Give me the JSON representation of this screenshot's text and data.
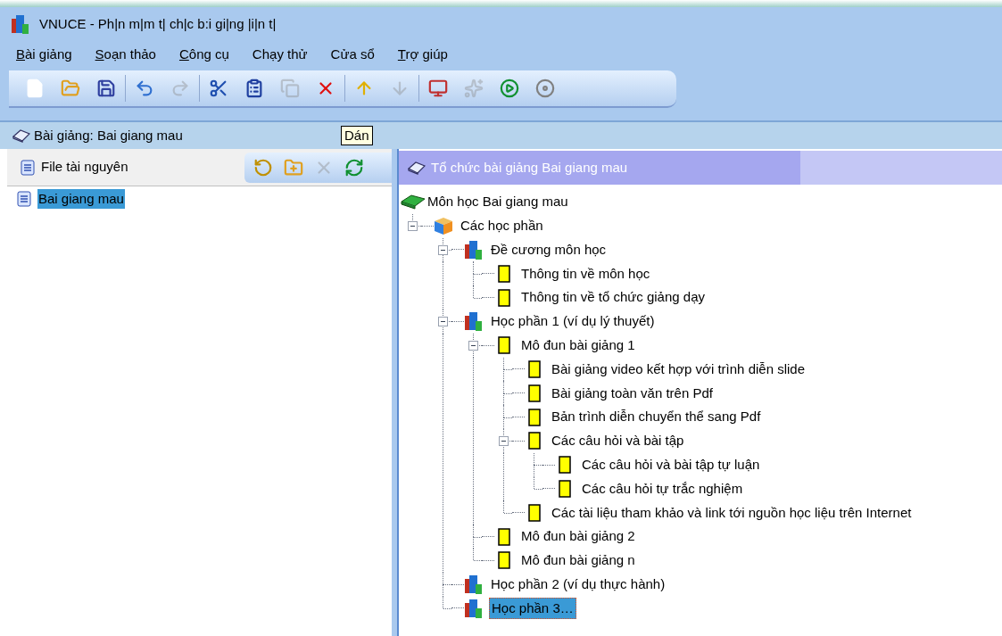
{
  "window": {
    "title": "VNUCE - Ph|n m|m t| ch|c b:i gi|ng |i|n t|"
  },
  "menu": [
    {
      "label": "Bài giảng",
      "underline_first": true
    },
    {
      "label": "Soạn thảo",
      "underline_first": true
    },
    {
      "label": "Công cụ",
      "underline_first": true
    },
    {
      "label": "Chạy thử",
      "underline_first": false
    },
    {
      "label": "Cửa sổ",
      "underline_first": false
    },
    {
      "label": "Trợ giúp",
      "underline_first": true
    }
  ],
  "toolbar": {
    "groups": [
      [
        {
          "disabled": false
        },
        {
          "disabled": false
        },
        {
          "disabled": false
        }
      ],
      [
        {
          "disabled": false
        },
        {
          "disabled": true
        }
      ],
      [
        {
          "disabled": false
        },
        {
          "disabled": false
        },
        {
          "disabled": true
        },
        {
          "disabled": false
        }
      ],
      [
        {
          "disabled": false
        },
        {
          "disabled": true
        }
      ],
      [
        {
          "disabled": false
        },
        {
          "disabled": true
        },
        {
          "disabled": false
        },
        {
          "disabled": false
        }
      ]
    ]
  },
  "lecture_bar": {
    "label": "Bài giảng: Bai giang mau",
    "tooltip": "Dán"
  },
  "resource_panel": {
    "title": "File tài nguyên",
    "tools": [
      {
        "disabled": false
      },
      {
        "disabled": false
      },
      {
        "disabled": true
      },
      {
        "disabled": false
      }
    ],
    "items": [
      {
        "label": "Bai giang mau",
        "selected": true
      }
    ]
  },
  "structure_panel": {
    "title": "Tổ chức bài giảng Bai giang mau",
    "tree": {
      "label": "Môn học Bai giang mau",
      "kind": "subject",
      "selected": false,
      "children": [
        {
          "label": "Các học phần",
          "kind": "group",
          "selected": false,
          "expanded": true,
          "children": [
            {
              "label": "Đề cương môn học",
              "kind": "section",
              "selected": false,
              "expanded": true,
              "children": [
                {
                  "label": "Thông tin về môn học",
                  "kind": "page",
                  "selected": false
                },
                {
                  "label": "Thông tin về tổ chức giảng dạy",
                  "kind": "page",
                  "selected": false
                }
              ]
            },
            {
              "label": "Học phần 1 (ví dụ lý thuyết)",
              "kind": "section",
              "selected": false,
              "expanded": true,
              "children": [
                {
                  "label": "Mô đun bài giảng 1",
                  "kind": "page",
                  "selected": false,
                  "expanded": true,
                  "children": [
                    {
                      "label": "Bài giảng video kết hợp với trình diễn slide",
                      "kind": "page",
                      "selected": false
                    },
                    {
                      "label": "Bài giảng toàn văn trên Pdf",
                      "kind": "page",
                      "selected": false
                    },
                    {
                      "label": "Bản trình diễn chuyển thể sang Pdf",
                      "kind": "page",
                      "selected": false
                    },
                    {
                      "label": "Các câu hỏi và bài tập",
                      "kind": "page",
                      "selected": false,
                      "expanded": true,
                      "children": [
                        {
                          "label": "Các câu hỏi và bài tập tự luận",
                          "kind": "page",
                          "selected": false
                        },
                        {
                          "label": "Các câu hỏi tự trắc nghiệm",
                          "kind": "page",
                          "selected": false
                        }
                      ]
                    },
                    {
                      "label": "Các tài liệu tham khảo và link tới nguồn học liệu trên Internet",
                      "kind": "page",
                      "selected": false
                    }
                  ]
                },
                {
                  "label": "Mô đun bài giảng 2",
                  "kind": "page",
                  "selected": false
                },
                {
                  "label": "Mô đun bài giảng n",
                  "kind": "page",
                  "selected": false
                }
              ]
            },
            {
              "label": "Học phần 2 (ví dụ thực hành)",
              "kind": "section",
              "selected": false
            },
            {
              "label": "Học phần 3…",
              "kind": "section",
              "selected": true
            }
          ]
        }
      ]
    }
  }
}
